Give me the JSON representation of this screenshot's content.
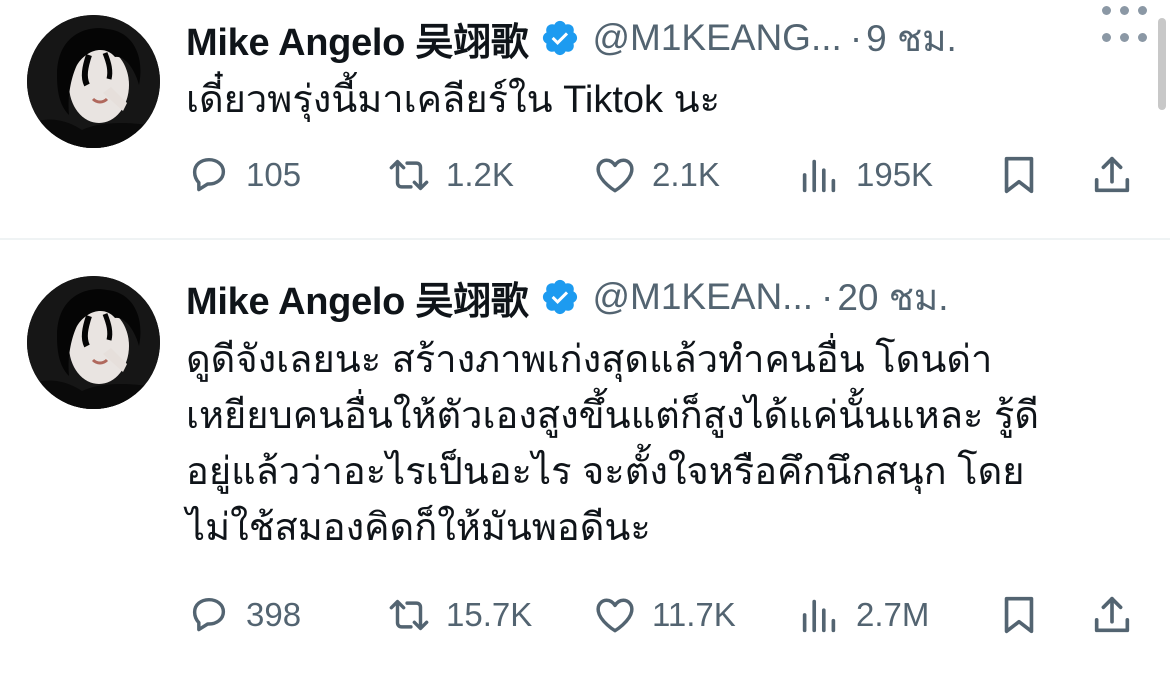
{
  "colors": {
    "accent": "#1d9bf0",
    "text": "#0f1419",
    "secondary": "#536471",
    "divider": "#eff3f4"
  },
  "tweets": [
    {
      "name": "Mike Angelo 吴翊歌",
      "handle": "@M1KEANG...",
      "separator": "·",
      "time": "9 ชม.",
      "text": "เดี๋ยวพรุ่งนี้มาเคลียร์ใน Tiktok นะ",
      "verified_icon": "verified-badge-icon",
      "stats": {
        "replies": "105",
        "retweets": "1.2K",
        "likes": "2.1K",
        "views": "195K"
      }
    },
    {
      "name": "Mike Angelo 吴翊歌",
      "handle": "@M1KEAN...",
      "separator": "·",
      "time": "20 ชม.",
      "text": "ดูดีจังเลยนะ สร้างภาพเก่งสุดแล้วทำคนอื่น โดนด่า\nเหยียบคนอื่นให้ตัวเองสูงขึ้นแต่ก็สูงได้แค่นั้นแหละ รู้ดี\nอยู่แล้วว่าอะไรเป็นอะไร จะตั้งใจหรือคึกนึกสนุก โดย\nไม่ใช้สมองคิดก็ให้มันพอดีนะ",
      "verified_icon": "verified-badge-icon",
      "stats": {
        "replies": "398",
        "retweets": "15.7K",
        "likes": "11.7K",
        "views": "2.7M"
      }
    }
  ],
  "icons": {
    "reply": "reply-icon",
    "retweet": "retweet-icon",
    "like": "heart-icon",
    "views": "views-chart-icon",
    "bookmark": "bookmark-icon",
    "share": "share-icon",
    "more": "more-dots-icon"
  }
}
